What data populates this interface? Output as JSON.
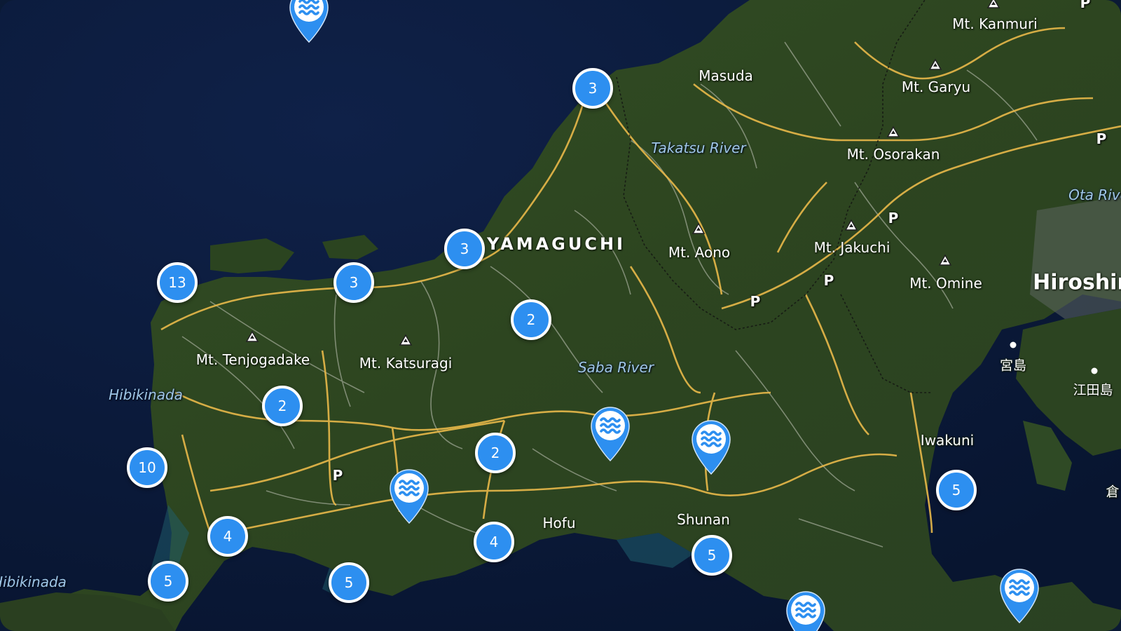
{
  "map": {
    "region_label": "YAMAGUCHI",
    "city_labels": [
      {
        "text": "Masuda"
      },
      {
        "text": "Hofu"
      },
      {
        "text": "Shunan"
      },
      {
        "text": "Iwakuni"
      },
      {
        "text": "Hiroshin"
      },
      {
        "text": "宮島"
      },
      {
        "text": "江田島"
      },
      {
        "text": "倉"
      }
    ],
    "water_labels": [
      {
        "text": "Takatsu River"
      },
      {
        "text": "Saba River"
      },
      {
        "text": "Ota Rive"
      },
      {
        "text": "Hibikinada"
      },
      {
        "text": "Hibikinada"
      }
    ],
    "mountain_labels": [
      {
        "text": "Mt. Kanmuri"
      },
      {
        "text": "Mt. Garyu"
      },
      {
        "text": "Mt. Osorakan"
      },
      {
        "text": "Mt. Aono"
      },
      {
        "text": "Mt. Jakuchi"
      },
      {
        "text": "Mt. Omine"
      },
      {
        "text": "Mt. Tenjogadake"
      },
      {
        "text": "Mt. Katsuragi"
      }
    ],
    "parking_label": "P",
    "clusters": [
      {
        "count": "3"
      },
      {
        "count": "3"
      },
      {
        "count": "13"
      },
      {
        "count": "3"
      },
      {
        "count": "2"
      },
      {
        "count": "2"
      },
      {
        "count": "10"
      },
      {
        "count": "2"
      },
      {
        "count": "4"
      },
      {
        "count": "5"
      },
      {
        "count": "5"
      },
      {
        "count": "4"
      },
      {
        "count": "5"
      },
      {
        "count": "5"
      }
    ],
    "water_pin_icon": "water-waves-icon",
    "colors": {
      "cluster": "#2d8ff0",
      "pin": "#2d8ff0",
      "road_major": "#e9b94a",
      "road_minor": "#9aa38f",
      "sea": "#0b1a35",
      "land": "#2f4a22"
    }
  }
}
